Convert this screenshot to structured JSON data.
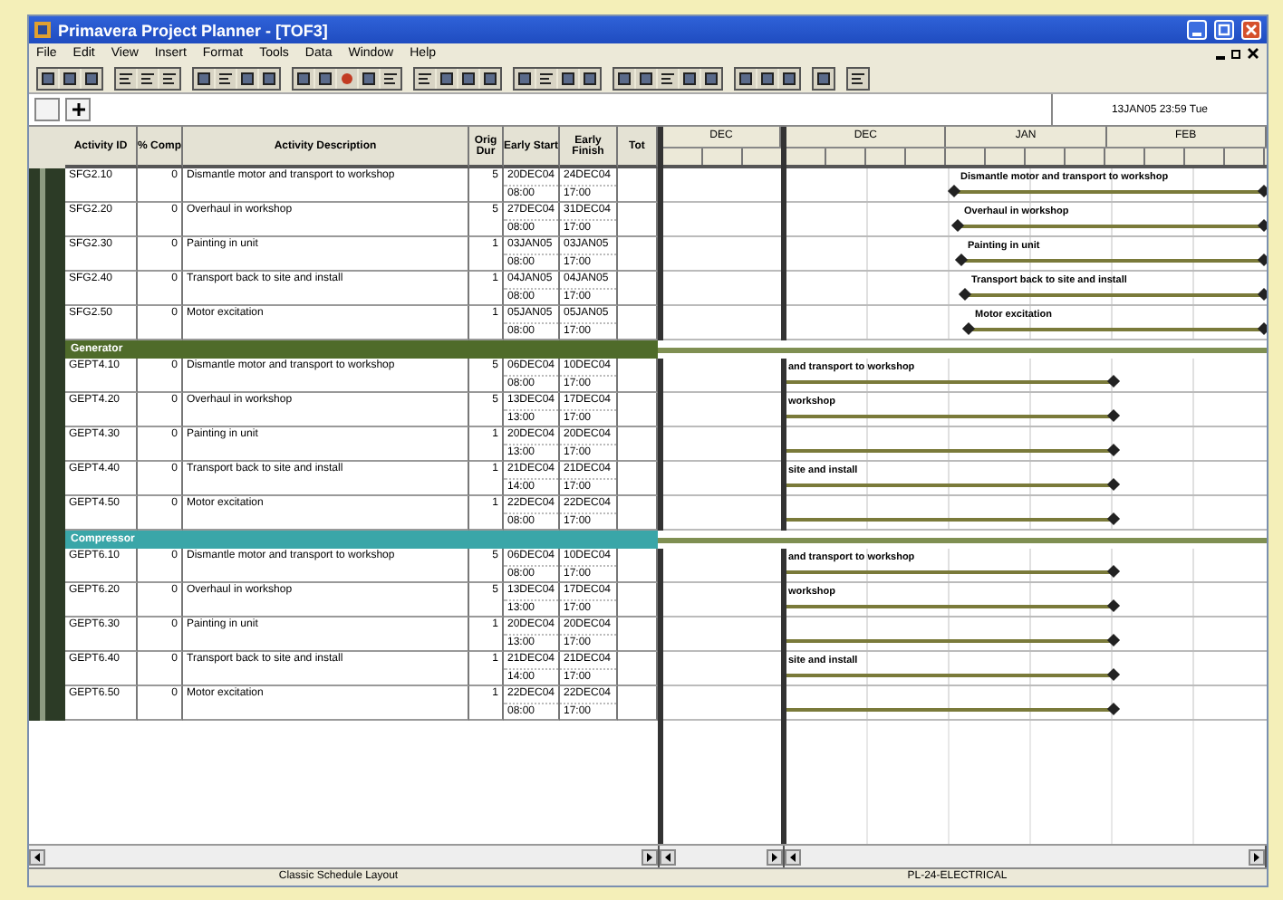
{
  "window": {
    "title": "Primavera Project Planner - [TOF3]"
  },
  "menu": [
    "File",
    "Edit",
    "View",
    "Insert",
    "Format",
    "Tools",
    "Data",
    "Window",
    "Help"
  ],
  "edit_bar": {
    "date": "13JAN05 23:59 Tue"
  },
  "columns": [
    {
      "label": "Activity ID"
    },
    {
      "label": "% Comp"
    },
    {
      "label": "Activity Description"
    },
    {
      "label": "Orig Dur"
    },
    {
      "label": "Early Start"
    },
    {
      "label": "Early Finish"
    },
    {
      "label": "Tot"
    }
  ],
  "timescale": {
    "pane_1": "DEC",
    "pane_2": [
      "DEC",
      "JAN",
      "FEB"
    ]
  },
  "groups": [
    {
      "kind": "later",
      "rows": [
        {
          "id": "SFG2.10",
          "pct": "0",
          "description": "Dismantle motor and transport to workshop",
          "dur": "5",
          "start_date": "20DEC04",
          "start_time": "08:00",
          "finish_date": "24DEC04",
          "finish_time": "17:00",
          "bar": "Dismantle motor and transport to workshop"
        },
        {
          "id": "SFG2.20",
          "pct": "0",
          "description": "Overhaul in workshop",
          "dur": "5",
          "start_date": "27DEC04",
          "start_time": "08:00",
          "finish_date": "31DEC04",
          "finish_time": "17:00",
          "bar": "Overhaul in workshop"
        },
        {
          "id": "SFG2.30",
          "pct": "0",
          "description": "Painting in unit",
          "dur": "1",
          "start_date": "03JAN05",
          "start_time": "08:00",
          "finish_date": "03JAN05",
          "finish_time": "17:00",
          "bar": "Painting in unit"
        },
        {
          "id": "SFG2.40",
          "pct": "0",
          "description": "Transport back to site and install",
          "dur": "1",
          "start_date": "04JAN05",
          "start_time": "08:00",
          "finish_date": "04JAN05",
          "finish_time": "17:00",
          "bar": "Transport back to site and install"
        },
        {
          "id": "SFG2.50",
          "pct": "0",
          "description": "Motor excitation",
          "dur": "1",
          "start_date": "05JAN05",
          "start_time": "08:00",
          "finish_date": "05JAN05",
          "finish_time": "17:00",
          "bar": "Motor excitation"
        }
      ]
    },
    {
      "kind": "earlier",
      "band": {
        "label": "Generator",
        "color": "#4f6b2a"
      },
      "rows": [
        {
          "id": "GEPT4.10",
          "pct": "0",
          "description": "Dismantle motor and transport to workshop",
          "dur": "5",
          "start_date": "06DEC04",
          "start_time": "08:00",
          "finish_date": "10DEC04",
          "finish_time": "17:00",
          "bar": "and transport to workshop"
        },
        {
          "id": "GEPT4.20",
          "pct": "0",
          "description": "Overhaul in workshop",
          "dur": "5",
          "start_date": "13DEC04",
          "start_time": "13:00",
          "finish_date": "17DEC04",
          "finish_time": "17:00",
          "bar": "workshop"
        },
        {
          "id": "GEPT4.30",
          "pct": "0",
          "description": "Painting in unit",
          "dur": "1",
          "start_date": "20DEC04",
          "start_time": "13:00",
          "finish_date": "20DEC04",
          "finish_time": "17:00",
          "bar": ""
        },
        {
          "id": "GEPT4.40",
          "pct": "0",
          "description": "Transport back to site and install",
          "dur": "1",
          "start_date": "21DEC04",
          "start_time": "14:00",
          "finish_date": "21DEC04",
          "finish_time": "17:00",
          "bar": "site and install"
        },
        {
          "id": "GEPT4.50",
          "pct": "0",
          "description": "Motor excitation",
          "dur": "1",
          "start_date": "22DEC04",
          "start_time": "08:00",
          "finish_date": "22DEC04",
          "finish_time": "17:00",
          "bar": ""
        }
      ]
    },
    {
      "kind": "earlier",
      "band": {
        "label": "Compressor",
        "color": "#3aa6a8"
      },
      "rows": [
        {
          "id": "GEPT6.10",
          "pct": "0",
          "description": "Dismantle motor and transport to workshop",
          "dur": "5",
          "start_date": "06DEC04",
          "start_time": "08:00",
          "finish_date": "10DEC04",
          "finish_time": "17:00",
          "bar": "and transport to workshop"
        },
        {
          "id": "GEPT6.20",
          "pct": "0",
          "description": "Overhaul in workshop",
          "dur": "5",
          "start_date": "13DEC04",
          "start_time": "13:00",
          "finish_date": "17DEC04",
          "finish_time": "17:00",
          "bar": "workshop"
        },
        {
          "id": "GEPT6.30",
          "pct": "0",
          "description": "Painting in unit",
          "dur": "1",
          "start_date": "20DEC04",
          "start_time": "13:00",
          "finish_date": "20DEC04",
          "finish_time": "17:00",
          "bar": ""
        },
        {
          "id": "GEPT6.40",
          "pct": "0",
          "description": "Transport back to site and install",
          "dur": "1",
          "start_date": "21DEC04",
          "start_time": "14:00",
          "finish_date": "21DEC04",
          "finish_time": "17:00",
          "bar": "site and install"
        },
        {
          "id": "GEPT6.50",
          "pct": "0",
          "description": "Motor excitation",
          "dur": "1",
          "start_date": "22DEC04",
          "start_time": "08:00",
          "finish_date": "22DEC04",
          "finish_time": "17:00",
          "bar": ""
        }
      ]
    }
  ],
  "status_bar": [
    "Classic Schedule Layout",
    "PL-24-ELECTRICAL"
  ]
}
